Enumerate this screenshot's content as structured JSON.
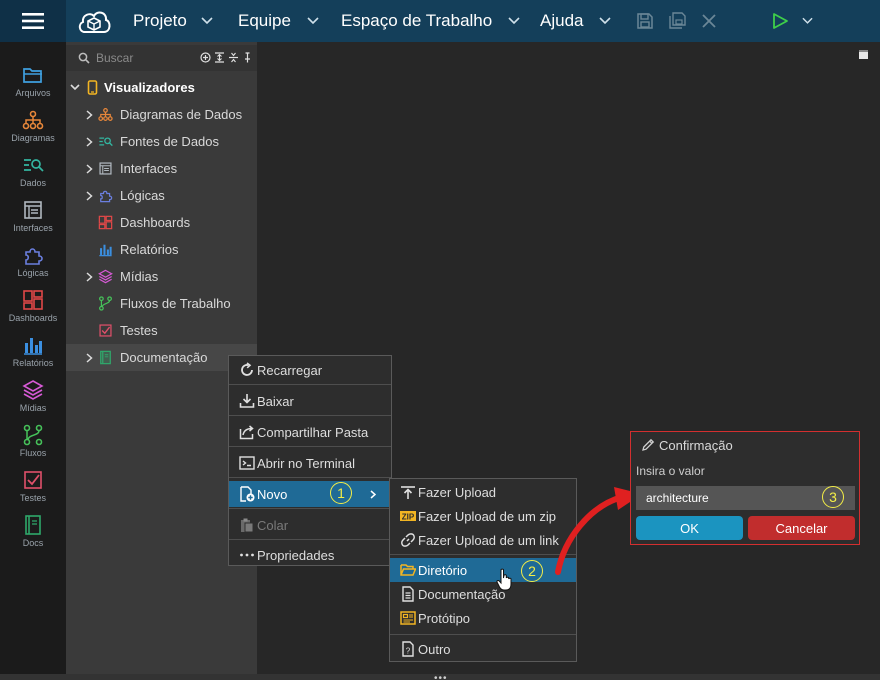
{
  "topbar": {
    "menus": [
      "Projeto",
      "Equipe",
      "Espaço de Trabalho",
      "Ajuda"
    ]
  },
  "iconbar": {
    "items": [
      {
        "label": "Arquivos",
        "icon": "folder-icon",
        "color": "#3fa0e0"
      },
      {
        "label": "Diagramas",
        "icon": "diagram-icon",
        "color": "#e8873a"
      },
      {
        "label": "Dados",
        "icon": "data-icon",
        "color": "#33b5a0"
      },
      {
        "label": "Interfaces",
        "icon": "interface-icon",
        "color": "#9aa3ab"
      },
      {
        "label": "Lógicas",
        "icon": "puzzle-icon",
        "color": "#6b7fe0"
      },
      {
        "label": "Dashboards",
        "icon": "dashboard-icon",
        "color": "#e04848"
      },
      {
        "label": "Relatórios",
        "icon": "report-icon",
        "color": "#3b8fe0"
      },
      {
        "label": "Mídias",
        "icon": "layers-icon",
        "color": "#d75ad6"
      },
      {
        "label": "Fluxos",
        "icon": "workflow-icon",
        "color": "#46c25a"
      },
      {
        "label": "Testes",
        "icon": "test-icon",
        "color": "#e0506a"
      },
      {
        "label": "Docs",
        "icon": "book-icon",
        "color": "#2fa86b"
      }
    ]
  },
  "explorer": {
    "search_placeholder": "Buscar",
    "root": "Visualizadores",
    "items": [
      {
        "label": "Diagramas de Dados",
        "icon": "diagram-icon",
        "color": "#e8873a",
        "expandable": true
      },
      {
        "label": "Fontes de Dados",
        "icon": "data-icon",
        "color": "#33b5a0",
        "expandable": true
      },
      {
        "label": "Interfaces",
        "icon": "interface-icon",
        "color": "#9aa3ab",
        "expandable": true
      },
      {
        "label": "Lógicas",
        "icon": "puzzle-icon",
        "color": "#6b7fe0",
        "expandable": true
      },
      {
        "label": "Dashboards",
        "icon": "dashboard-icon",
        "color": "#e04848",
        "expandable": false
      },
      {
        "label": "Relatórios",
        "icon": "report-icon",
        "color": "#3b8fe0",
        "expandable": false
      },
      {
        "label": "Mídias",
        "icon": "layers-icon",
        "color": "#d75ad6",
        "expandable": true
      },
      {
        "label": "Fluxos de Trabalho",
        "icon": "workflow-icon",
        "color": "#46c25a",
        "expandable": false
      },
      {
        "label": "Testes",
        "icon": "test-icon",
        "color": "#e0506a",
        "expandable": false
      },
      {
        "label": "Documentação",
        "icon": "book-icon",
        "color": "#2fa86b",
        "expandable": true
      }
    ]
  },
  "context_menu": {
    "items": [
      "Recarregar",
      "Baixar",
      "Compartilhar Pasta",
      "Abrir no Terminal",
      "Novo",
      "Colar",
      "Propriedades"
    ]
  },
  "submenu": {
    "items": [
      "Fazer Upload",
      "Fazer Upload de um zip",
      "Fazer Upload de um link",
      "Diretório",
      "Documentação",
      "Protótipo",
      "Outro"
    ]
  },
  "dialog": {
    "title": "Confirmação",
    "label": "Insira o valor",
    "value": "architecture",
    "ok": "OK",
    "cancel": "Cancelar"
  },
  "badges": [
    "1",
    "2",
    "3"
  ],
  "colors": {
    "accent": "#1b94c0",
    "topbar": "#143f5a",
    "danger": "#c12d2d",
    "highlight_ring": "#f4ee47",
    "arrow": "#e02020"
  }
}
